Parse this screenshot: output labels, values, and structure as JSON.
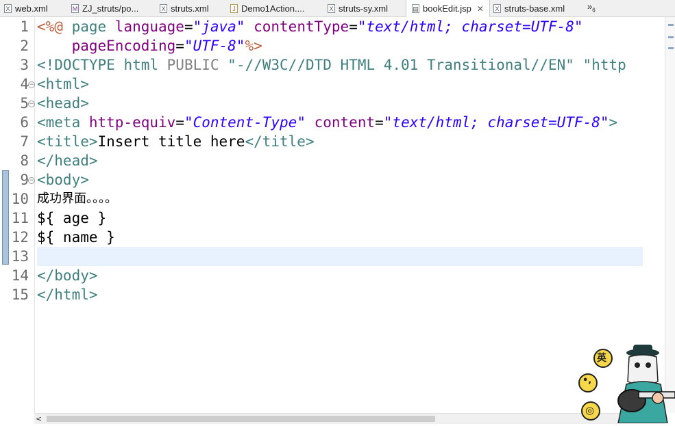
{
  "tabs": [
    {
      "label": "web.xml",
      "icon": "xml-file-icon",
      "active": false
    },
    {
      "label": "ZJ_struts/po...",
      "icon": "maven-pom-icon",
      "active": false
    },
    {
      "label": "struts.xml",
      "icon": "xml-file-icon",
      "active": false
    },
    {
      "label": "Demo1Action....",
      "icon": "java-file-icon",
      "active": false
    },
    {
      "label": "struts-sy.xml",
      "icon": "xml-file-icon",
      "active": false
    },
    {
      "label": "bookEdit.jsp",
      "icon": "jsp-file-icon",
      "active": true,
      "close": "✕"
    },
    {
      "label": "struts-base.xml",
      "icon": "xml-file-icon",
      "active": false
    }
  ],
  "overflow": {
    "label": "»",
    "count": "6"
  },
  "editor": {
    "line_numbers": [
      "1",
      "2",
      "3",
      "4",
      "5",
      "6",
      "7",
      "8",
      "9",
      "10",
      "11",
      "12",
      "13",
      "14",
      "15"
    ],
    "lines": {
      "l1": {
        "a": "<%@ ",
        "b": "page ",
        "c": "language",
        "d": "=",
        "e": "\"java\"",
        "f": " contentType",
        "g": "=",
        "h": "\"text/html; charset=UTF-8\""
      },
      "l2": {
        "a": "    pageEncoding",
        "b": "=",
        "c": "\"UTF-8\"",
        "d": "%>"
      },
      "l3": {
        "a": "<!DOCTYPE ",
        "b": "html ",
        "c": "PUBLIC ",
        "d": "\"-//W3C//DTD HTML 4.01 Transitional//EN\" ",
        "e": "\"http"
      },
      "l4": "<html>",
      "l5": "<head>",
      "l6": {
        "a": "<meta ",
        "b": "http-equiv",
        "c": "=",
        "d": "\"Content-Type\"",
        "e": " content",
        "f": "=",
        "g": "\"text/html; charset=UTF-8\"",
        "h": ">"
      },
      "l7": {
        "a": "<title>",
        "b": "Insert title here",
        "c": "</title>"
      },
      "l8": "</head>",
      "l9": "<body>",
      "l10": "成功界面。。。。",
      "l11": "${ age }",
      "l12": "${ name }",
      "l13": "",
      "l14": "</body>",
      "l15": "</html>"
    }
  },
  "mascot": {
    "badge1": "英",
    "badge2": "•,",
    "badge3": "◎"
  },
  "colors": {
    "tag": "#3f7f7f",
    "attr": "#7f007f",
    "string": "#2a00ff",
    "directive": "#bf5f3f",
    "current_line": "#e8f2fe"
  }
}
